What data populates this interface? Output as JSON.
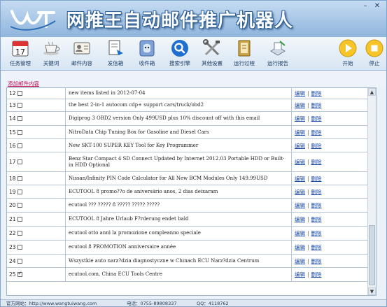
{
  "app": {
    "title": "网推王自动邮件推广机器人"
  },
  "toolbar": {
    "items": [
      {
        "label": "任务管理",
        "icon": "calendar-icon"
      },
      {
        "label": "关键词",
        "icon": "teacup-icon"
      },
      {
        "label": "邮件内容",
        "icon": "contact-card-icon"
      },
      {
        "label": "发信箱",
        "icon": "outbox-icon"
      },
      {
        "label": "收件箱",
        "icon": "inbox-icon"
      },
      {
        "label": "搜索引擎",
        "icon": "search-icon"
      },
      {
        "label": "其他设置",
        "icon": "tools-icon"
      },
      {
        "label": "运行过程",
        "icon": "book-icon"
      },
      {
        "label": "运行报告",
        "icon": "report-icon"
      },
      {
        "label": "开始",
        "icon": "play-icon"
      },
      {
        "label": "停止",
        "icon": "stop-icon"
      }
    ]
  },
  "add_link": "添加邮件内容",
  "actions": {
    "edit": "编辑",
    "separator": "|",
    "delete": "删除"
  },
  "rows": [
    {
      "num": "12",
      "checked": false,
      "title": "new items listed in 2012-07-04"
    },
    {
      "num": "13",
      "checked": false,
      "title": "the best 2-in-1 autocom cdp+ support cars/truck/obd2"
    },
    {
      "num": "14",
      "checked": false,
      "title": "Digiprog 3 OBD2 version Only 499USD plus 10% discount off with this email"
    },
    {
      "num": "15",
      "checked": false,
      "title": "NitroData Chip Tuning Box for Gasoline and Diesel Cars"
    },
    {
      "num": "16",
      "checked": false,
      "title": "New SKT-100 SUPER KEY Tool for Key Programmer"
    },
    {
      "num": "17",
      "checked": false,
      "title": "Benz Star Compact 4 SD Connect Updated by Internet 2012.03 Portable HDD or Built-in HDD Optional"
    },
    {
      "num": "18",
      "checked": false,
      "title": "Nissan/Infinity PIN Code Calculator for All New BCM Modules Only 149.99USD"
    },
    {
      "num": "19",
      "checked": false,
      "title": "ECUTOOL 8 promo??o de aniversário anos, 2 dias deixaram"
    },
    {
      "num": "20",
      "checked": false,
      "title": "ecutool ??? ????? 8 ????? ????? ?????"
    },
    {
      "num": "21",
      "checked": false,
      "title": "ECUTOOL 8 Jahre Urlaub F?rderung endet bald"
    },
    {
      "num": "22",
      "checked": false,
      "title": "ecutool otto anni la promozione compleanno speciale"
    },
    {
      "num": "23",
      "checked": false,
      "title": "ecutool 8 PROMOTION anniversaire année"
    },
    {
      "num": "24",
      "checked": false,
      "title": "Wszystkie auto narz?dzia diagnostyczne w Chinach ECU Narz?dzia Centrum"
    },
    {
      "num": "25",
      "checked": true,
      "title": "ecutool.com, China ECU Tools Centre"
    }
  ],
  "status": {
    "website": "官方网站：http://www.wangtuiwang.com",
    "phone": "电话：0755-89808337",
    "qq": "QQ：4118762"
  },
  "colors": {
    "titlebar": "#a7c6e6",
    "link": "#1a4aa8",
    "add_link": "#c0145b"
  }
}
